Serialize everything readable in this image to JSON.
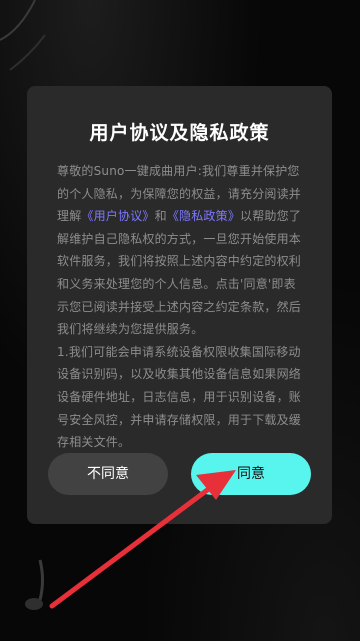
{
  "dialog": {
    "title": "用户协议及隐私政策",
    "para1_pre": "尊敬的Suno一键成曲用户:我们尊重并保护您的个人隐私，为保障您的权益，请充分阅读并理解",
    "user_agreement_link": "《用户协议》",
    "and": "和",
    "privacy_policy_link": "《隐私政策》",
    "para1_post": "以帮助您了解维护自己隐私权的方式，一旦您开始使用本软件服务，我们将按照上述内容中约定的权利和义务来处理您的个人信息。点击'同意'即表示您已阅读并接受上述内容之约定条款，然后我们将继续为您提供服务。",
    "para2": "1.我们可能会申请系统设备权限收集国际移动设备识别码，以及收集其他设备信息如果网络设备硬件地址，日志信息，用于识别设备，账号安全风控，并申请存储权限，用于下载及缓存相关文件。",
    "disagree_label": "不同意",
    "agree_label": "同意"
  },
  "colors": {
    "accent": "#57f5ee",
    "link": "#7d78ff",
    "arrow": "#e8303a"
  }
}
